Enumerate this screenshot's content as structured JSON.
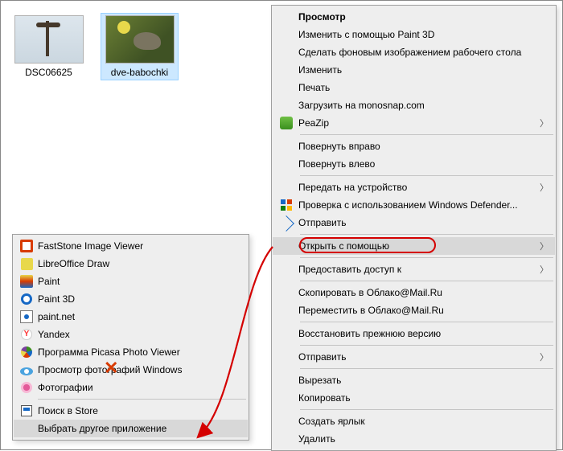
{
  "files": [
    {
      "label": "DSC06625",
      "selected": false
    },
    {
      "label": "dve-babochki",
      "selected": true
    }
  ],
  "context_menu": {
    "view": "Просмотр",
    "edit_paint3d": "Изменить с помощью Paint 3D",
    "set_wallpaper": "Сделать фоновым изображением рабочего стола",
    "edit": "Изменить",
    "print": "Печать",
    "monosnap": "Загрузить на monosnap.com",
    "peazip": "PeaZip",
    "rotate_right": "Повернуть вправо",
    "rotate_left": "Повернуть влево",
    "cast": "Передать на устройство",
    "defender": "Проверка с использованием Windows Defender...",
    "send": "Отправить",
    "open_with": "Открыть с помощью",
    "share_access": "Предоставить доступ к",
    "copy_mailru": "Скопировать в Облако@Mail.Ru",
    "move_mailru": "Переместить в Облако@Mail.Ru",
    "restore": "Восстановить прежнюю версию",
    "send_to": "Отправить",
    "cut": "Вырезать",
    "copy": "Копировать",
    "shortcut": "Создать ярлык",
    "delete": "Удалить"
  },
  "open_with_menu": {
    "items": [
      "FastStone Image Viewer",
      "LibreOffice Draw",
      "Paint",
      "Paint 3D",
      "paint.net",
      "Yandex",
      "Программа Picasa Photo Viewer",
      "Просмотр фотографий Windows",
      "Фотографии"
    ],
    "store": "Поиск в Store",
    "choose_other": "Выбрать другое приложение"
  }
}
